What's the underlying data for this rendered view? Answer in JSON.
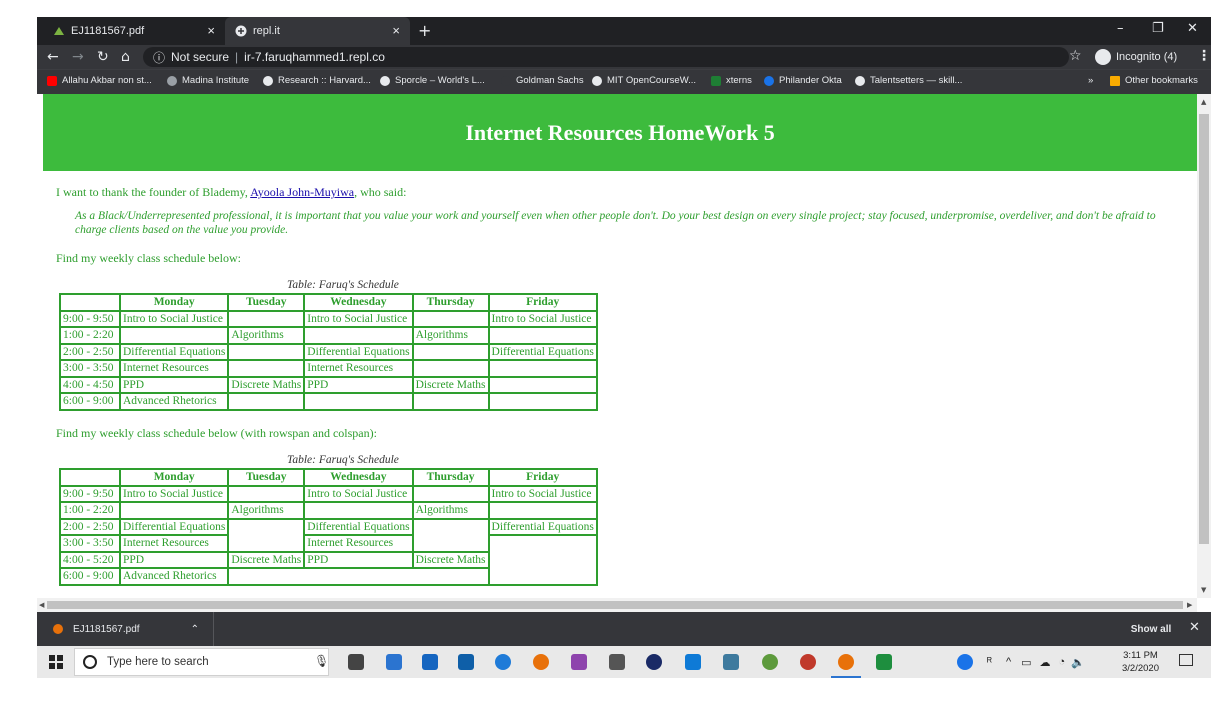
{
  "browser": {
    "tabs": [
      {
        "title": "EJ1181567.pdf",
        "active": false
      },
      {
        "title": "repl.it",
        "active": true
      }
    ],
    "new_tab_symbol": "+",
    "tab_close_symbol": "×",
    "window_controls": {
      "minimize": "–",
      "maximize": "❐",
      "close": "✕"
    },
    "address": {
      "security": "Not secure",
      "url": "ir-7.faruqhammed1.repl.co"
    },
    "profile": "Incognito (4)",
    "bookmarks": [
      {
        "label": "Allahu Akbar non st...",
        "icon_color": "#ff0000"
      },
      {
        "label": "Madina Institute",
        "icon_color": "#9aa0a6"
      },
      {
        "label": "Research :: Harvard...",
        "icon_color": "#e8eaed"
      },
      {
        "label": "Sporcle – World's L...",
        "icon_color": "#e8eaed"
      },
      {
        "label": "Goldman Sachs",
        "icon_color": "#35363a"
      },
      {
        "label": "MIT OpenCourseW...",
        "icon_color": "#e8eaed"
      },
      {
        "label": "xterns",
        "icon_color": "#1e7e34"
      },
      {
        "label": "Philander Okta",
        "icon_color": "#1a73e8"
      },
      {
        "label": "Talentsetters — skill...",
        "icon_color": "#e8eaed"
      }
    ],
    "bookmarks_overflow": "»",
    "other_bookmarks": "Other bookmarks"
  },
  "page": {
    "title": "Internet Resources HomeWork 5",
    "thanks_prefix": "I want to thank the founder of Blademy, ",
    "thanks_link": "Ayoola John-Muyiwa",
    "thanks_suffix": ", who said:",
    "quote": "As a Black/Underrepresented professional, it is important that you value your work and yourself even when other people don't. Do your best design on every single project; stay focused, underpromise, overdeliver, and don't be afraid to charge clients based on the value you provide.",
    "schedule_intro_1": "Find my weekly class schedule below:",
    "schedule_intro_2": "Find my weekly class schedule below (with rowspan and colspan):",
    "caption": "Table: Faruq's Schedule",
    "days": [
      "Monday",
      "Tuesday",
      "Wednesday",
      "Thursday",
      "Friday"
    ],
    "table1": [
      [
        "9:00 - 9:50",
        "Intro to Social Justice",
        "",
        "Intro to Social Justice",
        "",
        "Intro to Social Justice"
      ],
      [
        "1:00 - 2:20",
        "",
        "Algorithms",
        "",
        "Algorithms",
        ""
      ],
      [
        "2:00 - 2:50",
        "Differential Equations",
        "",
        "Differential Equations",
        "",
        "Differential Equations"
      ],
      [
        "3:00 - 3:50",
        "Internet Resources",
        "",
        "Internet Resources",
        "",
        ""
      ],
      [
        "4:00 - 4:50",
        "PPD",
        "Discrete Maths",
        "PPD",
        "Discrete Maths",
        ""
      ],
      [
        "6:00 - 9:00",
        "Advanced Rhetorics",
        "",
        "",
        "",
        ""
      ]
    ],
    "table2": {
      "r1": [
        "9:00 - 9:50",
        "Intro to Social Justice",
        "",
        "Intro to Social Justice",
        "",
        "Intro to Social Justice"
      ],
      "r2": [
        "1:00 - 2:20",
        "",
        "Algorithms",
        "",
        "Algorithms",
        ""
      ],
      "r3": [
        "2:00 - 2:50",
        "Differential Equations",
        "",
        "Differential Equations",
        "",
        "Differential Equations"
      ],
      "r4": [
        "3:00 - 3:50",
        "Internet Resources",
        "Internet Resources"
      ],
      "r5": [
        "4:00 - 5:20",
        "PPD",
        "Discrete Maths",
        "PPD",
        "Discrete Maths"
      ],
      "r6": [
        "6:00 - 9:00",
        "Advanced Rhetorics",
        ""
      ]
    }
  },
  "downloads": {
    "file": "EJ1181567.pdf",
    "show_all": "Show all"
  },
  "taskbar": {
    "search_placeholder": "Type here to search",
    "time": "3:11 PM",
    "date": "3/2/2020"
  },
  "colors": {
    "header_green": "#3dbb3d",
    "text_green": "#2e9e2e",
    "link_blue": "#1a0dab"
  }
}
